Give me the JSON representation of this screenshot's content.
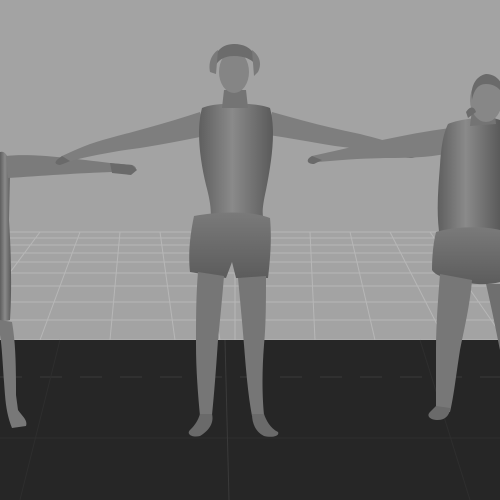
{
  "viewport": {
    "background": "#a3a3a3",
    "floor_color": "#262626",
    "grid_color": "#b9b9b9",
    "model_color": "#6f6f6f",
    "model_shadow": "#4a4a4a"
  },
  "models": [
    {
      "label": "human-scan-left",
      "pose": "t-pose",
      "visibility": "partially-offscreen"
    },
    {
      "label": "human-scan-center",
      "pose": "t-pose",
      "visibility": "full"
    },
    {
      "label": "human-scan-right",
      "pose": "t-pose",
      "visibility": "partially-offscreen"
    }
  ]
}
